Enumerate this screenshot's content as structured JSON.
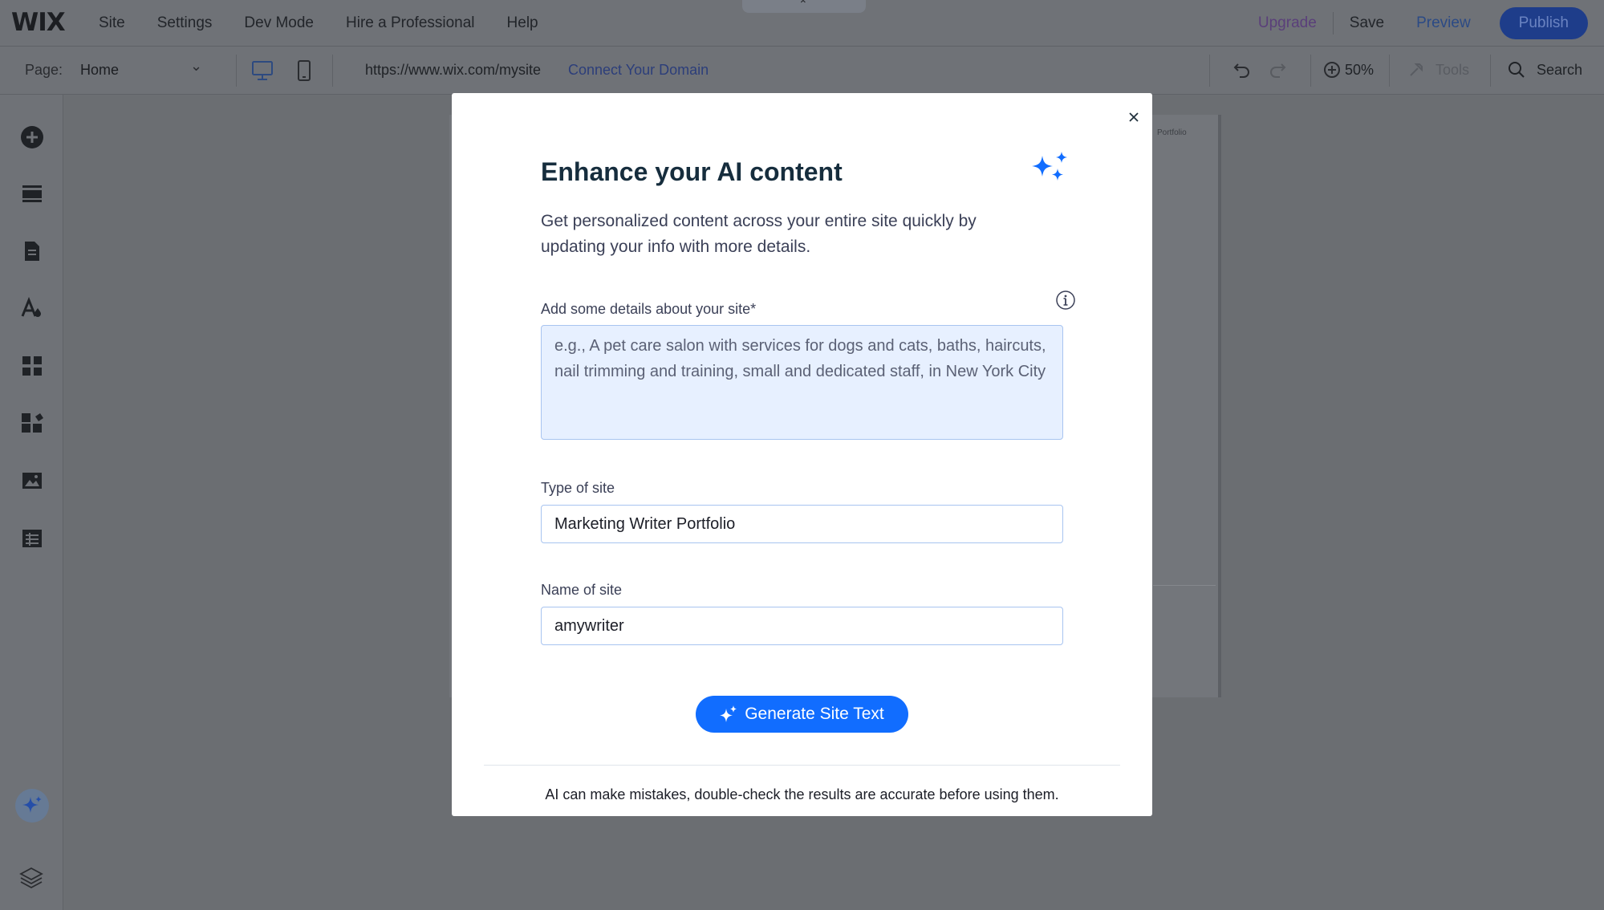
{
  "app": {
    "logo": "WIX"
  },
  "topbar": {
    "menu": [
      "Site",
      "Settings",
      "Dev Mode",
      "Hire a Professional",
      "Help"
    ],
    "upgrade": "Upgrade",
    "save": "Save",
    "preview": "Preview",
    "publish": "Publish"
  },
  "secondbar": {
    "page_label": "Page:",
    "page_value": "Home",
    "url": "https://www.wix.com/mysite",
    "connect_domain": "Connect Your Domain",
    "zoom": "50%",
    "tools": "Tools",
    "search": "Search"
  },
  "canvas": {
    "top_label": "Portfolio"
  },
  "modal": {
    "title": "Enhance your AI content",
    "description": "Get personalized content across your entire site quickly by updating your info with more details.",
    "details_label": "Add some details about your site*",
    "details_placeholder": "e.g., A pet care salon with services for dogs and cats, baths, haircuts, nail trimming and training, small and dedicated staff, in New York City",
    "type_label": "Type of site",
    "type_value": "Marketing Writer Portfolio",
    "name_label": "Name of site",
    "name_value": "amywriter",
    "generate_button": "Generate Site Text",
    "disclaimer": "AI can make mistakes, double-check the results are accurate before using them."
  },
  "colors": {
    "accent": "#116dff",
    "overlay": "#6b6e72",
    "title": "#162d3d",
    "input_bg": "#e7f0ff"
  }
}
